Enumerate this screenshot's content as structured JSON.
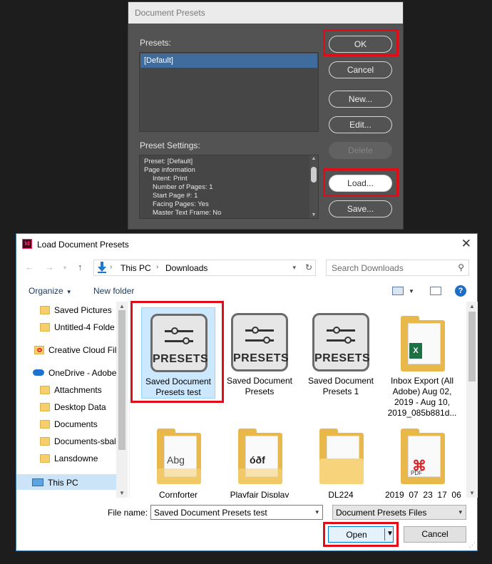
{
  "presets_dialog": {
    "title": "Document Presets",
    "presets_label": "Presets:",
    "presets": [
      "[Default]"
    ],
    "settings_label": "Preset Settings:",
    "settings_lines": [
      "Preset: [Default]",
      "Page information",
      "Intent: Print",
      "Number of Pages: 1",
      "Start Page #: 1",
      "Facing Pages: Yes",
      "Master Text Frame: No"
    ],
    "buttons": {
      "ok": "OK",
      "cancel": "Cancel",
      "new": "New...",
      "edit": "Edit...",
      "delete": "Delete",
      "load": "Load...",
      "save": "Save..."
    }
  },
  "load_dialog": {
    "app_icon": "Id",
    "title": "Load Document Presets",
    "breadcrumb": [
      "This PC",
      "Downloads"
    ],
    "search_placeholder": "Search Downloads",
    "toolbar": {
      "organize": "Organize",
      "new_folder": "New folder"
    },
    "nav_items": [
      {
        "label": "Saved Pictures",
        "icon": "folder-icon"
      },
      {
        "label": "Untitled-4 Folde",
        "icon": "folder-icon"
      },
      {
        "label": "Creative Cloud Fil",
        "icon": "creative-cloud-icon"
      },
      {
        "label": "OneDrive - Adobe",
        "icon": "onedrive-icon"
      },
      {
        "label": "Attachments",
        "icon": "folder-icon"
      },
      {
        "label": "Desktop Data",
        "icon": "folder-icon"
      },
      {
        "label": "Documents",
        "icon": "folder-icon"
      },
      {
        "label": "Documents-sbal",
        "icon": "folder-icon"
      },
      {
        "label": "Lansdowne",
        "icon": "folder-icon"
      },
      {
        "label": "This PC",
        "icon": "this-pc-icon"
      }
    ],
    "files": [
      {
        "label": "Saved Document Presets test",
        "icon": "presets-icon",
        "icon_text": "PRESETS"
      },
      {
        "label": "Saved Document Presets",
        "icon": "presets-icon",
        "icon_text": "PRESETS"
      },
      {
        "label": "Saved Document Presets 1",
        "icon": "presets-icon",
        "icon_text": "PRESETS"
      },
      {
        "label": "Inbox Export (All Adobe) Aug 02, 2019 - Aug 10, 2019_085b881d...",
        "icon": "folder-excel-icon"
      },
      {
        "label": "Cornforter",
        "icon": "folder-font-icon",
        "glyph": "Abg"
      },
      {
        "label": "Playfair Display",
        "icon": "folder-font-icon",
        "glyph": "óðf"
      },
      {
        "label": "DL224",
        "icon": "folder-icon"
      },
      {
        "label": "2019_07_23_17_06",
        "icon": "folder-pdf-icon",
        "badge": "PDF"
      }
    ],
    "file_name_label": "File name:",
    "file_name_value": "Saved Document Presets test",
    "file_type_value": "Document Presets Files",
    "open_label": "Open",
    "cancel_label": "Cancel"
  },
  "colors": {
    "highlight": "#e20c18",
    "selection": "#cce8ff",
    "indesign_bg": "#535353"
  }
}
